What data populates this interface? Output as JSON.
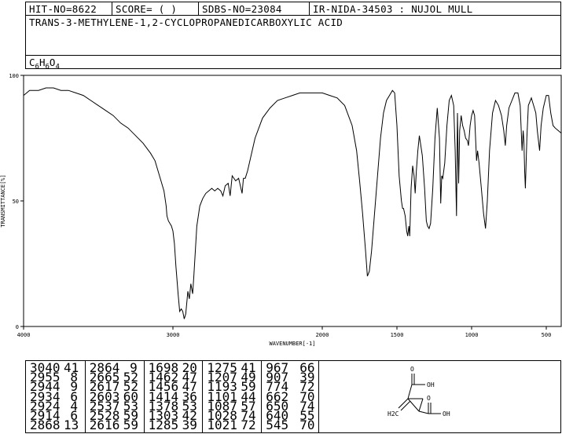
{
  "header": {
    "hit_no": "HIT-NO=8622",
    "score": "SCORE=  (   )",
    "sdbs_no": "SDBS-NO=23084",
    "ir_info": "IR-NIDA-34503 : NUJOL MULL",
    "compound_name": "TRANS-3-METHYLENE-1,2-CYCLOPROPANEDICARBOXYLIC ACID",
    "formula": {
      "c": "C",
      "c_n": "6",
      "h": "H",
      "h_n": "6",
      "o": "O",
      "o_n": "4"
    }
  },
  "chart_data": {
    "type": "line",
    "title": "",
    "xlabel": "WAVENUMBER[-1]",
    "ylabel": "TRANSMITTANCE[%]",
    "xlim": [
      4000,
      400
    ],
    "ylim": [
      0,
      100
    ],
    "x_ticks": [
      4000,
      3000,
      2000,
      1500,
      1000,
      500
    ],
    "x_tick_labels": [
      "4000",
      "3000",
      "2000",
      "1500",
      "1000",
      "500"
    ],
    "y_ticks": [
      0,
      50,
      100
    ],
    "y_tick_labels": [
      "0",
      "50",
      "100"
    ],
    "grid": false,
    "series": [
      {
        "color": "#000000",
        "points": [
          [
            4000,
            92
          ],
          [
            3960,
            94
          ],
          [
            3900,
            94
          ],
          [
            3850,
            95
          ],
          [
            3800,
            95
          ],
          [
            3750,
            94
          ],
          [
            3700,
            94
          ],
          [
            3650,
            93
          ],
          [
            3600,
            92
          ],
          [
            3550,
            90
          ],
          [
            3500,
            88
          ],
          [
            3450,
            86
          ],
          [
            3400,
            84
          ],
          [
            3350,
            81
          ],
          [
            3300,
            79
          ],
          [
            3250,
            76
          ],
          [
            3200,
            73
          ],
          [
            3150,
            69
          ],
          [
            3120,
            66
          ],
          [
            3100,
            62
          ],
          [
            3080,
            58
          ],
          [
            3060,
            54
          ],
          [
            3045,
            48
          ],
          [
            3040,
            44
          ],
          [
            3030,
            42
          ],
          [
            3010,
            40
          ],
          [
            3000,
            38
          ],
          [
            2990,
            33
          ],
          [
            2980,
            24
          ],
          [
            2965,
            13
          ],
          [
            2955,
            6
          ],
          [
            2944,
            7
          ],
          [
            2934,
            6
          ],
          [
            2924,
            3
          ],
          [
            2914,
            5
          ],
          [
            2900,
            14
          ],
          [
            2890,
            11
          ],
          [
            2880,
            17
          ],
          [
            2868,
            13
          ],
          [
            2860,
            20
          ],
          [
            2850,
            30
          ],
          [
            2840,
            40
          ],
          [
            2820,
            48
          ],
          [
            2800,
            51
          ],
          [
            2780,
            53
          ],
          [
            2760,
            54
          ],
          [
            2740,
            55
          ],
          [
            2720,
            54
          ],
          [
            2700,
            55
          ],
          [
            2680,
            54
          ],
          [
            2665,
            52
          ],
          [
            2650,
            56
          ],
          [
            2630,
            57
          ],
          [
            2617,
            52
          ],
          [
            2603,
            60
          ],
          [
            2580,
            58
          ],
          [
            2560,
            59
          ],
          [
            2537,
            53
          ],
          [
            2528,
            59
          ],
          [
            2516,
            59
          ],
          [
            2500,
            62
          ],
          [
            2450,
            75
          ],
          [
            2400,
            83
          ],
          [
            2350,
            87
          ],
          [
            2300,
            90
          ],
          [
            2250,
            91
          ],
          [
            2200,
            92
          ],
          [
            2150,
            93
          ],
          [
            2100,
            93
          ],
          [
            2050,
            93
          ],
          [
            2000,
            93
          ],
          [
            1950,
            92
          ],
          [
            1900,
            91
          ],
          [
            1850,
            88
          ],
          [
            1800,
            80
          ],
          [
            1770,
            70
          ],
          [
            1750,
            58
          ],
          [
            1730,
            45
          ],
          [
            1710,
            30
          ],
          [
            1698,
            20
          ],
          [
            1685,
            22
          ],
          [
            1670,
            30
          ],
          [
            1650,
            45
          ],
          [
            1630,
            60
          ],
          [
            1610,
            75
          ],
          [
            1590,
            85
          ],
          [
            1570,
            90
          ],
          [
            1550,
            92
          ],
          [
            1530,
            94
          ],
          [
            1515,
            93
          ],
          [
            1500,
            80
          ],
          [
            1485,
            60
          ],
          [
            1470,
            50
          ],
          [
            1462,
            47
          ],
          [
            1456,
            47
          ],
          [
            1445,
            44
          ],
          [
            1435,
            38
          ],
          [
            1428,
            36
          ],
          [
            1420,
            40
          ],
          [
            1414,
            36
          ],
          [
            1405,
            55
          ],
          [
            1395,
            64
          ],
          [
            1385,
            60
          ],
          [
            1378,
            53
          ],
          [
            1370,
            62
          ],
          [
            1360,
            70
          ],
          [
            1350,
            76
          ],
          [
            1340,
            72
          ],
          [
            1330,
            68
          ],
          [
            1315,
            55
          ],
          [
            1303,
            42
          ],
          [
            1295,
            40
          ],
          [
            1285,
            39
          ],
          [
            1275,
            41
          ],
          [
            1260,
            55
          ],
          [
            1245,
            75
          ],
          [
            1230,
            87
          ],
          [
            1215,
            75
          ],
          [
            1207,
            49
          ],
          [
            1200,
            60
          ],
          [
            1193,
            59
          ],
          [
            1180,
            65
          ],
          [
            1165,
            80
          ],
          [
            1150,
            90
          ],
          [
            1135,
            92
          ],
          [
            1120,
            88
          ],
          [
            1110,
            70
          ],
          [
            1101,
            44
          ],
          [
            1095,
            85
          ],
          [
            1087,
            57
          ],
          [
            1080,
            78
          ],
          [
            1070,
            84
          ],
          [
            1060,
            80
          ],
          [
            1050,
            78
          ],
          [
            1040,
            75
          ],
          [
            1028,
            74
          ],
          [
            1021,
            72
          ],
          [
            1010,
            80
          ],
          [
            1000,
            84
          ],
          [
            990,
            86
          ],
          [
            980,
            84
          ],
          [
            967,
            66
          ],
          [
            960,
            70
          ],
          [
            950,
            65
          ],
          [
            935,
            55
          ],
          [
            920,
            45
          ],
          [
            907,
            39
          ],
          [
            895,
            50
          ],
          [
            880,
            70
          ],
          [
            860,
            85
          ],
          [
            840,
            90
          ],
          [
            820,
            88
          ],
          [
            800,
            84
          ],
          [
            785,
            78
          ],
          [
            774,
            72
          ],
          [
            765,
            80
          ],
          [
            750,
            87
          ],
          [
            730,
            90
          ],
          [
            710,
            93
          ],
          [
            690,
            93
          ],
          [
            675,
            88
          ],
          [
            662,
            70
          ],
          [
            655,
            78
          ],
          [
            650,
            74
          ],
          [
            645,
            62
          ],
          [
            640,
            55
          ],
          [
            630,
            75
          ],
          [
            620,
            88
          ],
          [
            600,
            91
          ],
          [
            585,
            88
          ],
          [
            570,
            85
          ],
          [
            560,
            78
          ],
          [
            545,
            70
          ],
          [
            535,
            80
          ],
          [
            520,
            87
          ],
          [
            500,
            92
          ],
          [
            485,
            92
          ],
          [
            470,
            85
          ],
          [
            455,
            80
          ],
          [
            440,
            79
          ],
          [
            420,
            78
          ],
          [
            400,
            77
          ]
        ]
      }
    ]
  },
  "peak_table": [
    [
      [
        "3040",
        "41"
      ],
      [
        "2955",
        "8"
      ],
      [
        "2944",
        "9"
      ],
      [
        "2934",
        "6"
      ],
      [
        "2924",
        "4"
      ],
      [
        "2914",
        "6"
      ],
      [
        "2868",
        "13"
      ]
    ],
    [
      [
        "2864",
        "9"
      ],
      [
        "2665",
        "52"
      ],
      [
        "2617",
        "52"
      ],
      [
        "2603",
        "60"
      ],
      [
        "2537",
        "53"
      ],
      [
        "2528",
        "59"
      ],
      [
        "2616",
        "59"
      ]
    ],
    [
      [
        "1698",
        "20"
      ],
      [
        "1462",
        "47"
      ],
      [
        "1456",
        "47"
      ],
      [
        "1414",
        "36"
      ],
      [
        "1378",
        "53"
      ],
      [
        "1303",
        "42"
      ],
      [
        "1285",
        "39"
      ]
    ],
    [
      [
        "1275",
        "41"
      ],
      [
        "1207",
        "49"
      ],
      [
        "1193",
        "59"
      ],
      [
        "1101",
        "44"
      ],
      [
        "1087",
        "57"
      ],
      [
        "1028",
        "74"
      ],
      [
        "1021",
        "72"
      ]
    ],
    [
      [
        "967",
        "66"
      ],
      [
        "907",
        "39"
      ],
      [
        "774",
        "72"
      ],
      [
        "662",
        "70"
      ],
      [
        "650",
        "74"
      ],
      [
        "640",
        "55"
      ],
      [
        "545",
        "70"
      ]
    ]
  ],
  "structure": {
    "top_group": "OH",
    "bottom_group": "OH",
    "left_group": "H2C",
    "carbonyl_o": "O"
  }
}
